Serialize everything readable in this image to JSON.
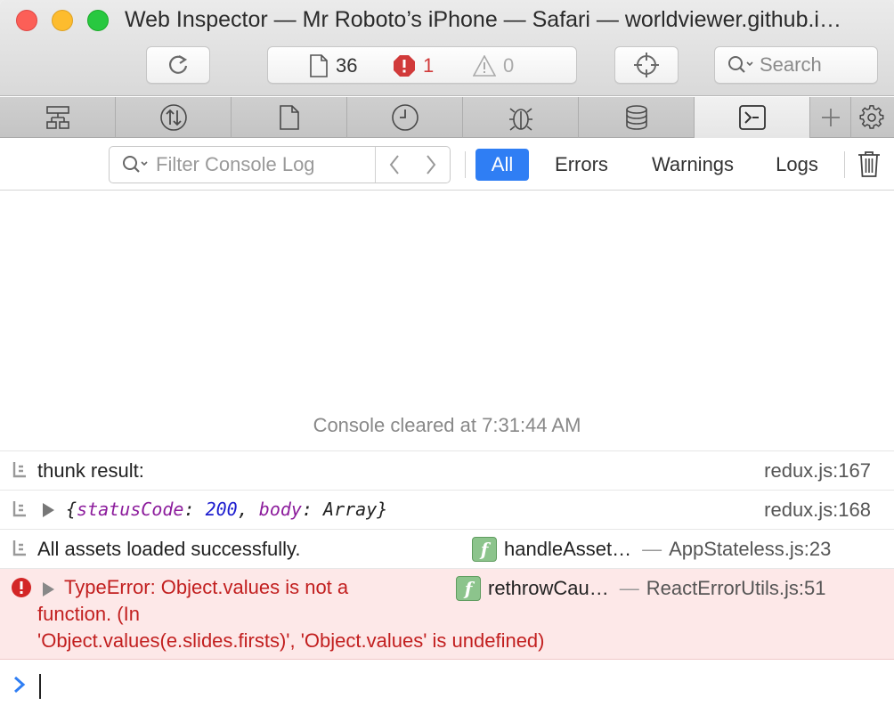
{
  "window": {
    "title": "Web Inspector — Mr Roboto’s iPhone — Safari — worldviewer.github.i…"
  },
  "toolbar": {
    "resources_count": "36",
    "errors_count": "1",
    "warnings_count": "0",
    "search_placeholder": "Search"
  },
  "tabs": [
    {
      "icon": "elements-icon"
    },
    {
      "icon": "network-icon"
    },
    {
      "icon": "resources-icon"
    },
    {
      "icon": "timelines-icon"
    },
    {
      "icon": "debugger-icon"
    },
    {
      "icon": "storage-icon"
    },
    {
      "icon": "console-icon",
      "selected": true
    }
  ],
  "filter": {
    "placeholder": "Filter Console Log",
    "buttons": {
      "all": "All",
      "errors": "Errors",
      "warnings": "Warnings",
      "logs": "Logs"
    }
  },
  "console": {
    "cleared": "Console cleared at 7:31:44 AM",
    "rows": [
      {
        "message": "thunk result:",
        "location": "redux.js:167"
      },
      {
        "object": {
          "open": "{",
          "key1": "statusCode",
          "colon1": ":",
          "value1": "200",
          "comma": ",",
          "key2": "body",
          "colon2": ":",
          "value2": "Array",
          "close": "}"
        },
        "location": "redux.js:168"
      },
      {
        "message": "All assets loaded successfully.",
        "function": "handleAsset…",
        "location": "AppStateless.js:23"
      },
      {
        "line1": "TypeError: Object.values is not a",
        "line2": "function. (In",
        "line3": "'Object.values(e.slides.firsts)', 'Object.values' is undefined)",
        "function": "rethrowCau…",
        "location": "ReactErrorUtils.js:51"
      }
    ],
    "dash": "—",
    "badge": "f"
  },
  "colors": {
    "accent": "#2f7ef4",
    "error": "#c21f1f",
    "error_bg": "#fde8e8"
  }
}
